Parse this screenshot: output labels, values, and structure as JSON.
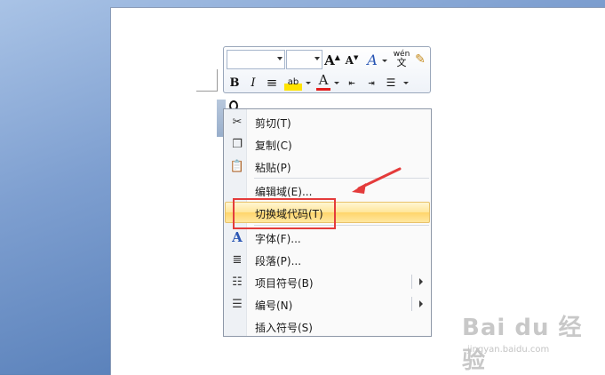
{
  "mini_toolbar": {
    "font_name": "",
    "font_size": "",
    "grow_font": "A",
    "shrink_font": "A",
    "styles": "A",
    "format_painter": "wén",
    "bold": "B",
    "italic": "I",
    "align": "≡",
    "highlight": "ab",
    "font_color": "A"
  },
  "context_menu": {
    "items": [
      {
        "label": "剪切(T)",
        "icon": "scissors-icon"
      },
      {
        "label": "复制(C)",
        "icon": "copy-icon"
      },
      {
        "label": "粘贴(P)",
        "icon": "paste-icon"
      },
      {
        "label": "编辑域(E)...",
        "icon": ""
      },
      {
        "label": "切换域代码(T)",
        "icon": "",
        "highlighted": true
      },
      {
        "label": "字体(F)...",
        "icon": "font-icon"
      },
      {
        "label": "段落(P)...",
        "icon": "paragraph-icon"
      },
      {
        "label": "项目符号(B)",
        "icon": "bullets-icon",
        "submenu": true
      },
      {
        "label": "编号(N)",
        "icon": "numbering-icon",
        "submenu": true
      },
      {
        "label": "插入符号(S)",
        "icon": ""
      }
    ]
  },
  "annotation": {
    "box_color": "#e43b3b",
    "arrow_color": "#e43b3b"
  },
  "watermark": {
    "brand": "Bai du 经验",
    "url": "jingyan.baidu.com"
  }
}
